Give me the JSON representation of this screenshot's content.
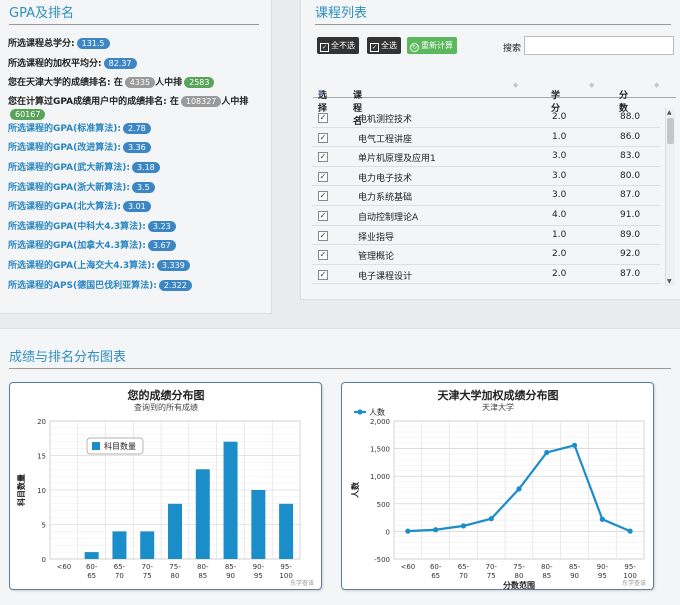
{
  "left": {
    "title": "GPA及排名",
    "rows": [
      {
        "label": "所选课程总学分:",
        "badge": "131.5",
        "style": "dark"
      },
      {
        "label": "所选课程的加权平均分:",
        "badge": "82.37",
        "style": "dark"
      },
      {
        "label": "您在天津大学的成绩排名: 在",
        "badge": "4335",
        "mid": "人中排",
        "badge2": "2583",
        "style": "rank"
      },
      {
        "label": "您在计算过GPA成绩用户中的成绩排名: 在",
        "badge": "108327",
        "mid": "人中排",
        "badge2": "60167",
        "style": "rank-tall"
      },
      {
        "label": "所选课程的GPA(标准算法):",
        "badge": "2.78",
        "style": "blue"
      },
      {
        "label": "所选课程的GPA(改进算法):",
        "badge": "3.36",
        "style": "blue"
      },
      {
        "label": "所选课程的GPA(武大新算法):",
        "badge": "3.18",
        "style": "blue"
      },
      {
        "label": "所选课程的GPA(浙大新算法):",
        "badge": "3.5",
        "style": "blue"
      },
      {
        "label": "所选课程的GPA(北大算法):",
        "badge": "3.01",
        "style": "blue"
      },
      {
        "label": "所选课程的GPA(中科大4.3算法):",
        "badge": "3.23",
        "style": "blue"
      },
      {
        "label": "所选课程的GPA(加拿大4.3算法):",
        "badge": "3.67",
        "style": "blue"
      },
      {
        "label": "所选课程的GPA(上海交大4.3算法):",
        "badge": "3.339",
        "style": "blue"
      },
      {
        "label": "所选课程的APS(德国巴伐利亚算法):",
        "badge": "2.322",
        "style": "blue"
      }
    ]
  },
  "courses": {
    "title": "课程列表",
    "btn_none": "全不选",
    "btn_all": "全选",
    "btn_recalc": "重新计算",
    "search_label": "搜索",
    "search_value": "",
    "headers": {
      "select": "选择",
      "name": "课程名",
      "credit": "学分",
      "score": "分数"
    },
    "rows": [
      {
        "name": "电机测控技术",
        "credit": "2.0",
        "score": "88.0"
      },
      {
        "name": "电气工程讲座",
        "credit": "1.0",
        "score": "86.0"
      },
      {
        "name": "单片机原理及应用1",
        "credit": "3.0",
        "score": "83.0"
      },
      {
        "name": "电力电子技术",
        "credit": "3.0",
        "score": "80.0"
      },
      {
        "name": "电力系统基础",
        "credit": "3.0",
        "score": "87.0"
      },
      {
        "name": "自动控制理论A",
        "credit": "4.0",
        "score": "91.0"
      },
      {
        "name": "择业指导",
        "credit": "1.0",
        "score": "89.0"
      },
      {
        "name": "管理概论",
        "credit": "2.0",
        "score": "92.0"
      },
      {
        "name": "电子课程设计",
        "credit": "2.0",
        "score": "87.0"
      }
    ]
  },
  "bottom": {
    "title": "成绩与排名分布图表"
  },
  "colors": {
    "accent": "#2e8fc0",
    "bar": "#1b8dc9",
    "line": "#1b8dc9"
  },
  "chart_data": [
    {
      "type": "bar",
      "title": "您的成绩分布图",
      "subtitle": "查询到的所有成绩",
      "ylabel": "科目数量",
      "xlabel": "",
      "categories": [
        "<60",
        "60-65",
        "65-70",
        "70-75",
        "75-80",
        "80-85",
        "85-90",
        "90-95",
        "95-100"
      ],
      "series": [
        {
          "name": "科目数量",
          "values": [
            0,
            1,
            4,
            4,
            8,
            13,
            17,
            10,
            8
          ]
        }
      ],
      "ylim": [
        0,
        20
      ],
      "yticks": [
        "0",
        "5",
        "10",
        "15",
        "20"
      ],
      "legend": "top-left",
      "credit": "东学查该"
    },
    {
      "type": "line",
      "title": "天津大学加权成绩分布图",
      "subtitle": "天津大学",
      "ylabel": "人数",
      "xlabel": "分数范围",
      "categories": [
        "<60",
        "60-65",
        "65-70",
        "70-75",
        "75-80",
        "80-85",
        "85-90",
        "90-95",
        "95-100"
      ],
      "series": [
        {
          "name": "人数",
          "values": [
            5,
            30,
            100,
            230,
            770,
            1430,
            1560,
            220,
            5
          ]
        }
      ],
      "ylim": [
        -500,
        2000
      ],
      "yticks": [
        "-500",
        "0",
        "500",
        "1,000",
        "1,500",
        "2,000"
      ],
      "legend": "top-left",
      "credit": "东学查该"
    }
  ]
}
